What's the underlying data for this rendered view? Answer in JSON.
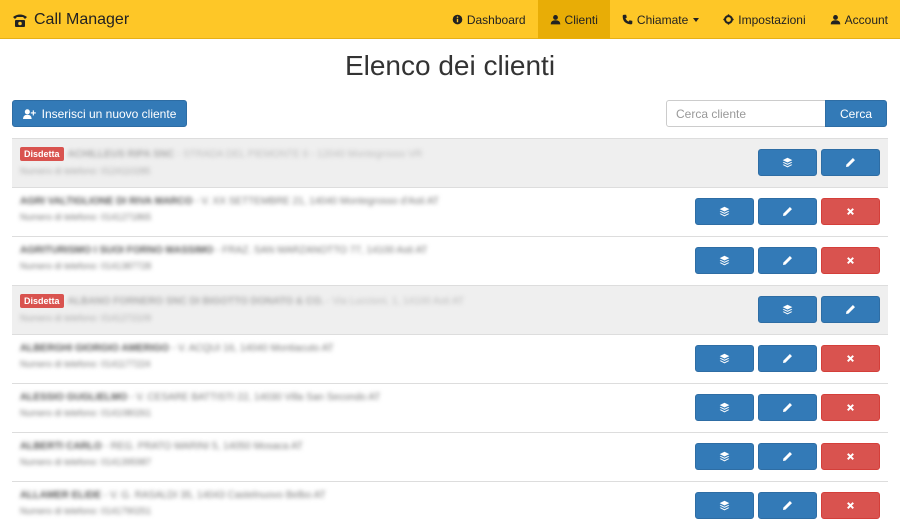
{
  "app": {
    "title": "Call Manager"
  },
  "nav": {
    "items": [
      {
        "label": "Dashboard",
        "icon": "info-circle-icon"
      },
      {
        "label": "Clienti",
        "icon": "user-icon",
        "active": true
      },
      {
        "label": "Chiamate",
        "icon": "phone-icon",
        "dropdown": true
      },
      {
        "label": "Impostazioni",
        "icon": "gear-icon"
      },
      {
        "label": "Account",
        "icon": "user-icon"
      }
    ]
  },
  "page": {
    "title": "Elenco dei clienti"
  },
  "toolbar": {
    "add_label": "Inserisci un nuovo cliente",
    "search_placeholder": "Cerca cliente",
    "search_label": "Cerca"
  },
  "badge_label": "Disdetta",
  "colors": {
    "navbar": "#fec727",
    "nav_active": "#e8ad06",
    "primary": "#337ab7",
    "danger": "#d9534f"
  },
  "clients": [
    {
      "name": "ACHILLEUS RIPA SNC",
      "address": "- STRADA DEL PIEMONTE 6 - 12040 Montegrosso VR",
      "phone": "Numero di telefono: 0124110285",
      "cancelled": true
    },
    {
      "name": "AGRI VALTIGLIONE DI RIVA MARCO",
      "address": "- V. XX SETTEMBRE 21, 14040 Montegrosso d'Asti AT",
      "phone": "Numero di telefono: 0141271865",
      "cancelled": false
    },
    {
      "name": "AGRITURISMO I SUOI FORNO MASSIMO",
      "address": "- FRAZ. SAN MARZANOTTO 77, 14100 Asti AT",
      "phone": "Numero di telefono: 0141387728",
      "cancelled": false
    },
    {
      "name": "ALBANO FORNERO SNC DI BIGOTTO DONATO & CO.",
      "address": "- Via Luccioni, 1, 14100 Asti AT",
      "phone": "Numero di telefono: 0141272109",
      "cancelled": true
    },
    {
      "name": "ALBERGHI GIORGIO AMERIGO",
      "address": "- V. ACQUI 16, 14040 Montiacuto AT",
      "phone": "Numero di telefono: 0141177224",
      "cancelled": false
    },
    {
      "name": "ALESSIO GUGLIELMO",
      "address": "- V. CESARE BATTISTI 22, 14030 Villa San Secondo AT",
      "phone": "Numero di telefono: 0141080261",
      "cancelled": false
    },
    {
      "name": "ALBERTI CARLO",
      "address": "- REG. PRATO MARINI 5, 14050 Mosaca AT",
      "phone": "Numero di telefono: 0141395987",
      "cancelled": false
    },
    {
      "name": "ALLAMER ELIDE",
      "address": "- V. G. RASALDI 35, 14043 Castelnuovo Belbo AT",
      "phone": "Numero di telefono: 0141790251",
      "cancelled": false
    }
  ]
}
